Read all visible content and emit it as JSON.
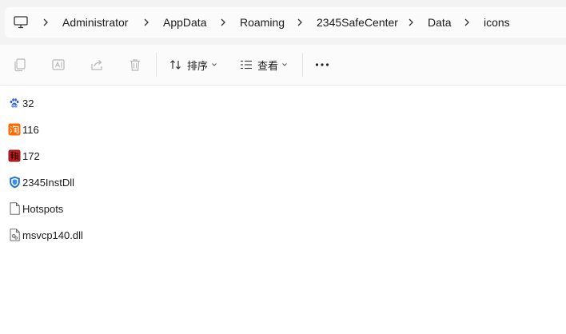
{
  "breadcrumb": {
    "root_icon": "computer-icon",
    "items": [
      {
        "label": "Administrator"
      },
      {
        "label": "AppData"
      },
      {
        "label": "Roaming"
      },
      {
        "label": "2345SafeCenter"
      },
      {
        "label": "Data"
      },
      {
        "label": "icons"
      }
    ]
  },
  "toolbar": {
    "copy_icon": "copy-icon",
    "rename_icon": "rename-icon",
    "share_icon": "share-icon",
    "delete_icon": "delete-icon",
    "sort_label": "排序",
    "view_label": "查看",
    "more_icon": "more-icon"
  },
  "files": [
    {
      "name": "32",
      "icon": "baidu-paw-icon"
    },
    {
      "name": "116",
      "icon": "taobao-icon"
    },
    {
      "name": "172",
      "icon": "game-dragon-icon"
    },
    {
      "name": "2345InstDll",
      "icon": "shield-icon"
    },
    {
      "name": "Hotspots",
      "icon": "blank-file-icon"
    },
    {
      "name": "msvcp140.dll",
      "icon": "dll-file-icon"
    }
  ],
  "colors": {
    "address_bg": "#f3f3f3",
    "toolbar_bg": "#fbfbfb",
    "disabled_icon": "#b8b8b8",
    "shield_blue": "#1f6fd6",
    "taobao_orange": "#ff6a00",
    "dragon_red": "#b01818"
  }
}
